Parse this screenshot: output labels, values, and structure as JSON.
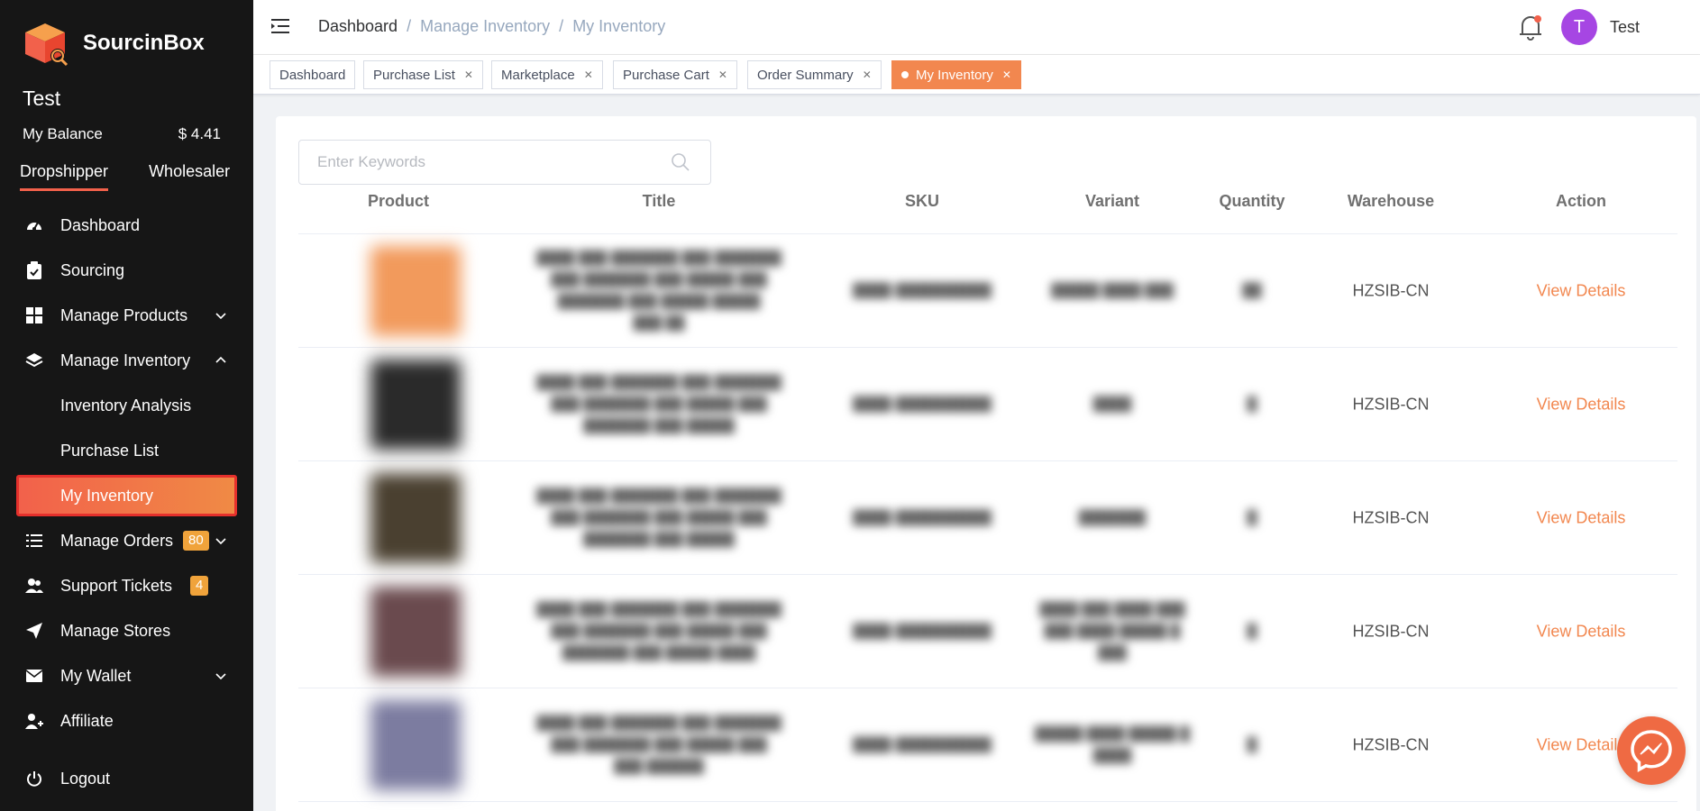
{
  "brand": {
    "name": "SourcinBox",
    "color": "#f2614b"
  },
  "sidebar": {
    "user_name": "Test",
    "balance_label": "My Balance",
    "balance_value": "$ 4.41",
    "modes": [
      "Dropshipper",
      "Wholesaler"
    ],
    "items": [
      {
        "label": "Dashboard",
        "icon": "gauge-icon"
      },
      {
        "label": "Sourcing",
        "icon": "clipboard-check-icon"
      },
      {
        "label": "Manage Products",
        "icon": "grid-icon"
      },
      {
        "label": "Manage Inventory",
        "icon": "layers-icon"
      },
      {
        "label": "Manage Orders",
        "icon": "list-icon",
        "badge": "80"
      },
      {
        "label": "Support Tickets",
        "icon": "users-icon",
        "badge": "4"
      },
      {
        "label": "Manage Stores",
        "icon": "paper-plane-icon"
      },
      {
        "label": "My Wallet",
        "icon": "envelope-icon"
      },
      {
        "label": "Affiliate",
        "icon": "user-plus-icon"
      },
      {
        "label": "Logout",
        "icon": "power-icon"
      }
    ],
    "inventory_sub": [
      "Inventory Analysis",
      "Purchase List",
      "My Inventory"
    ]
  },
  "header": {
    "breadcrumb": [
      "Dashboard",
      "/",
      "Manage Inventory",
      "/",
      "My Inventory"
    ],
    "avatar_letter": "T",
    "user": "Test"
  },
  "tags": [
    "Dashboard",
    "Purchase List",
    "Marketplace",
    "Purchase Cart",
    "Order Summary",
    "My Inventory"
  ],
  "search": {
    "placeholder": "Enter Keywords"
  },
  "table": {
    "columns": [
      "Product",
      "Title",
      "SKU",
      "Variant",
      "Quantity",
      "Warehouse",
      "Action"
    ],
    "rows": [
      {
        "warehouse": "HZSIB-CN",
        "action": "View Details",
        "thumb_color": "#f29a5c"
      },
      {
        "warehouse": "HZSIB-CN",
        "action": "View Details",
        "thumb_color": "#2a2a2a"
      },
      {
        "warehouse": "HZSIB-CN",
        "action": "View Details",
        "thumb_color": "#4a4030"
      },
      {
        "warehouse": "HZSIB-CN",
        "action": "View Details",
        "thumb_color": "#6a4a4e"
      },
      {
        "warehouse": "HZSIB-CN",
        "action": "View Details",
        "thumb_color": "#7c7ca0"
      }
    ]
  }
}
